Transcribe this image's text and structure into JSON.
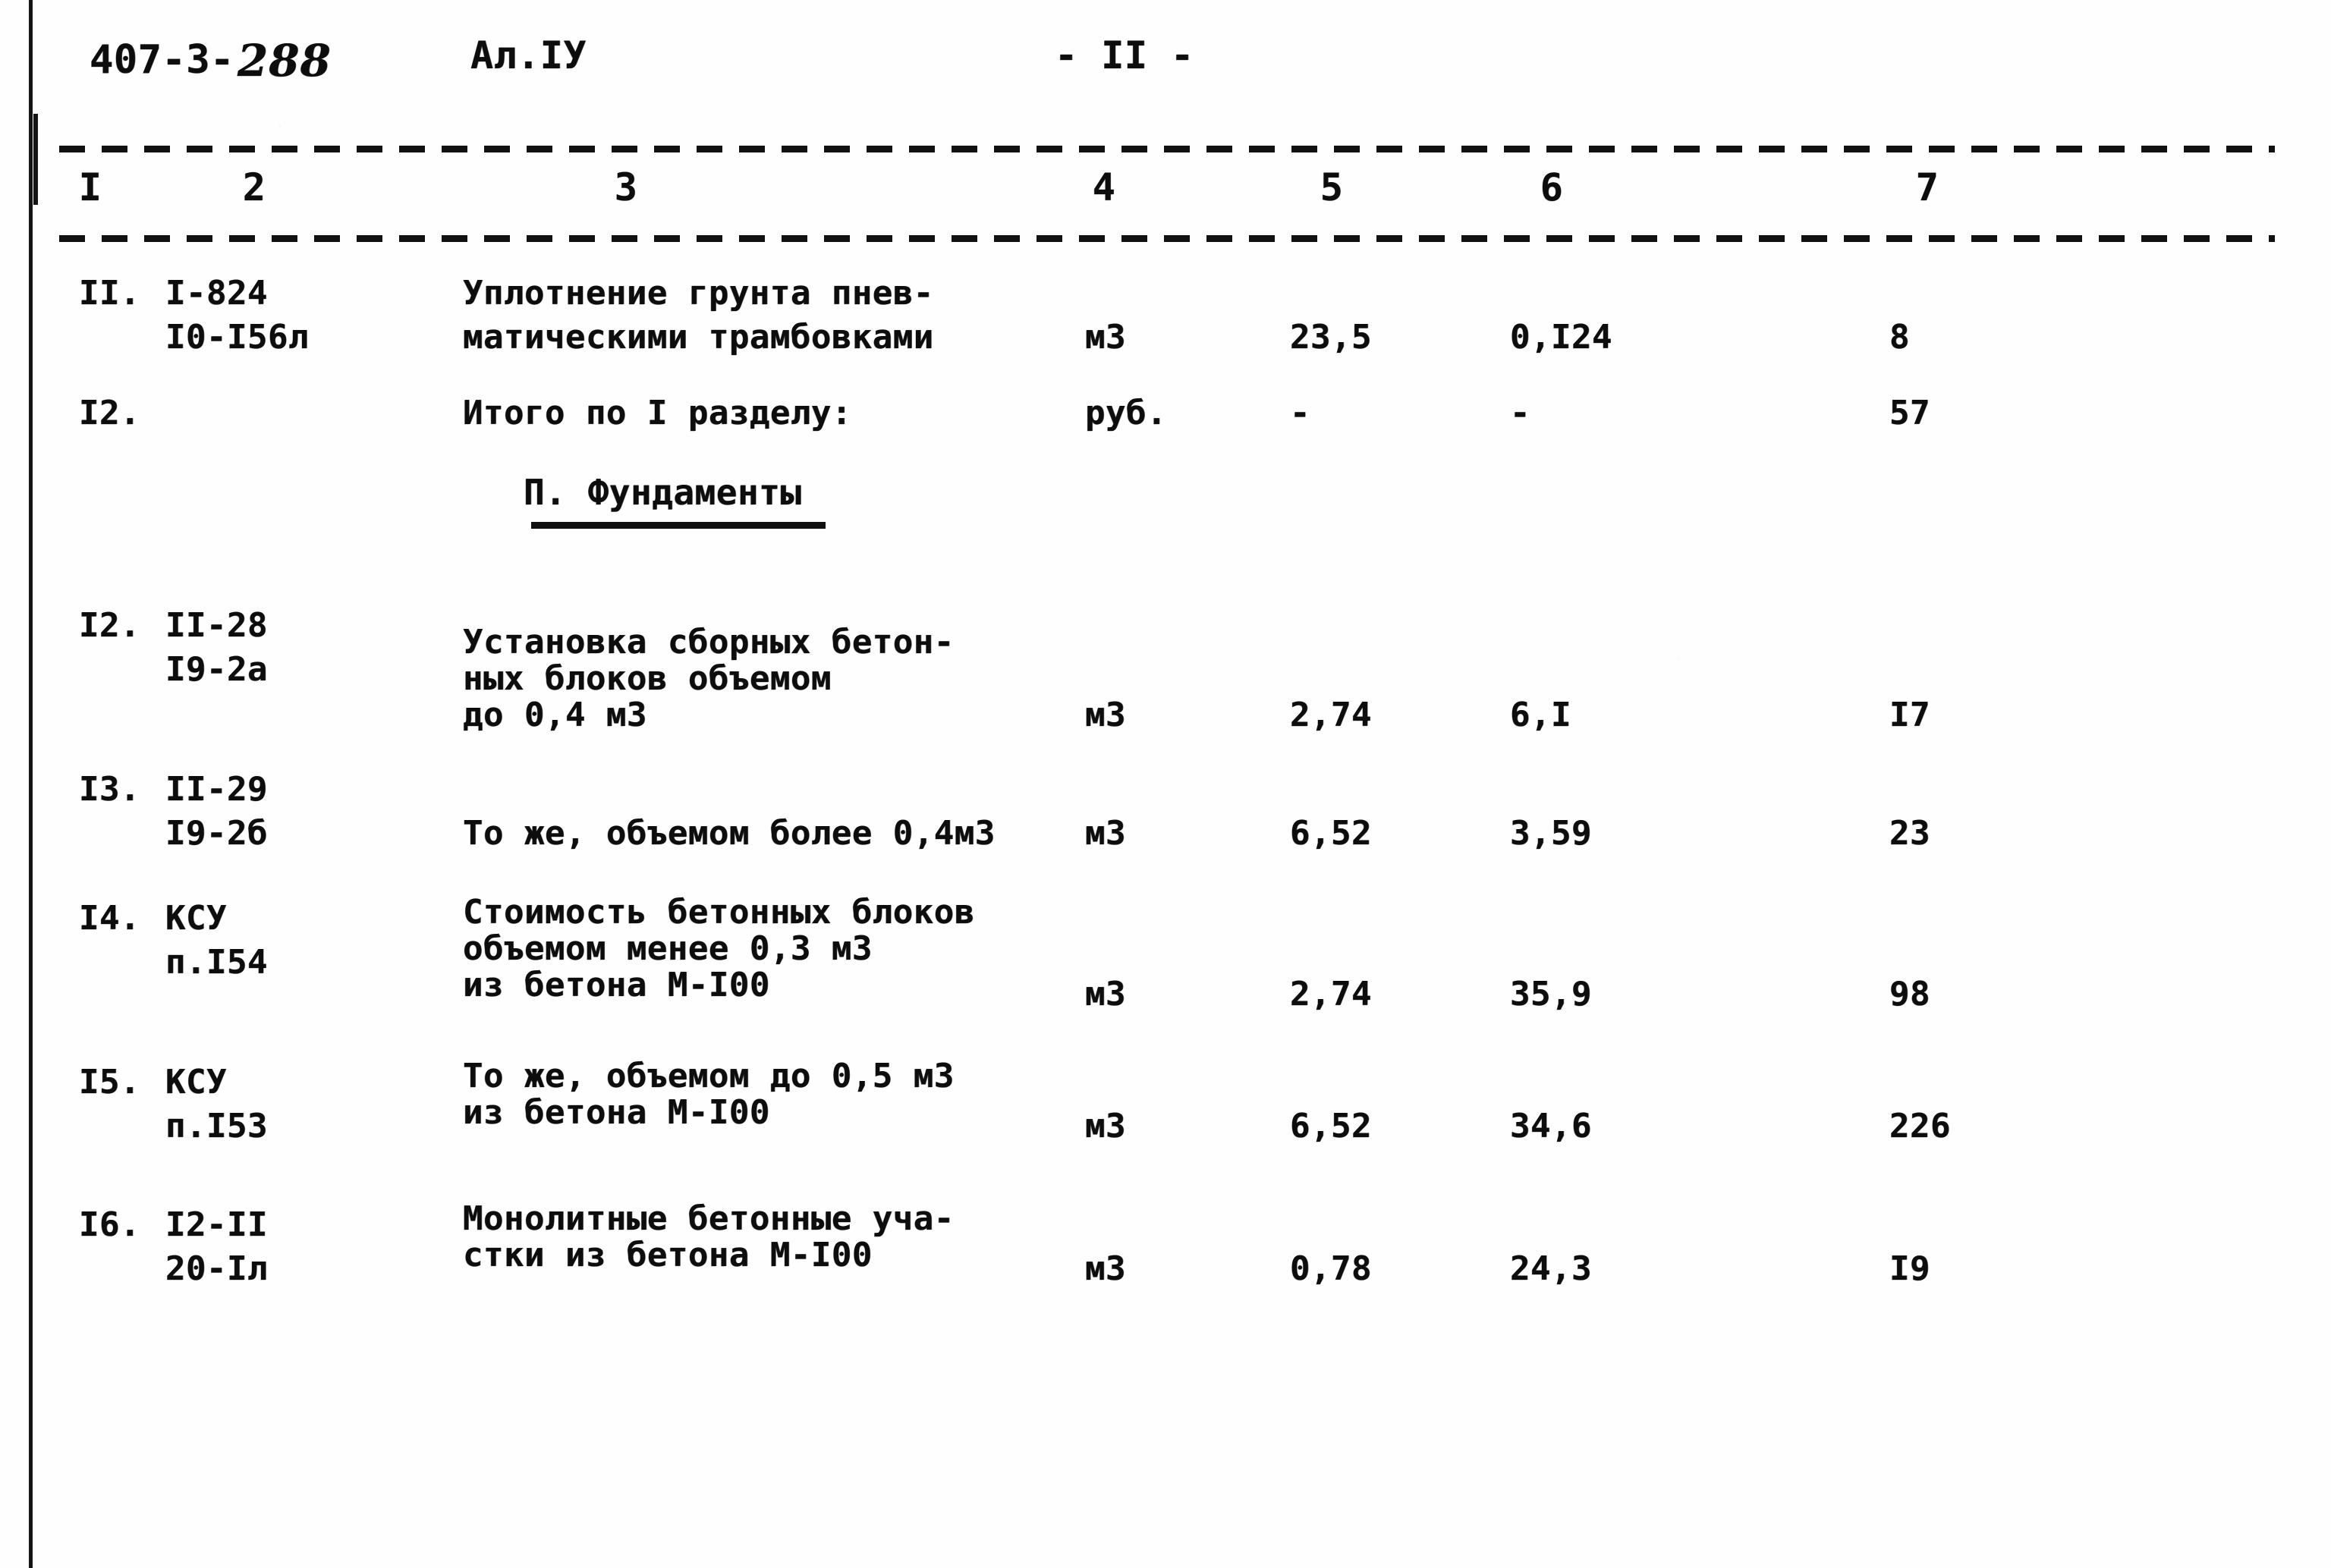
{
  "document": {
    "project_code_typed": "407-3-",
    "project_code_handwritten": "288",
    "album": "Ал.IУ",
    "page_marker": "- II -"
  },
  "table": {
    "column_numbers": [
      "I",
      "2",
      "3",
      "4",
      "5",
      "6",
      "7"
    ],
    "rows": [
      {
        "pos": "II.",
        "justification_line1": "I-824",
        "justification_line2": "I0-I56л",
        "name_line1": "Уплотнение грунта пнев-",
        "name_line2": "матическими трамбовками",
        "name_line3": "",
        "unit": "м3",
        "quantity": "23,5",
        "unit_price": "0,I24",
        "total": "8"
      },
      {
        "pos": "I2.",
        "justification_line1": "",
        "justification_line2": "",
        "name_line1": "Итого по I разделу:",
        "name_line2": "",
        "name_line3": "",
        "unit": "руб.",
        "quantity": "-",
        "unit_price": "-",
        "total": "57"
      },
      {
        "pos": "I2.",
        "justification_line1": "II-28",
        "justification_line2": "I9-2а",
        "name_line1": "Установка сборных бетон-",
        "name_line2": "ных блоков объемом",
        "name_line3": "до 0,4 м3",
        "unit": "м3",
        "quantity": "2,74",
        "unit_price": "6,I",
        "total": "I7"
      },
      {
        "pos": "I3.",
        "justification_line1": "II-29",
        "justification_line2": "I9-2б",
        "name_line1": "",
        "name_line2": "То же, объемом более 0,4м3",
        "name_line3": "",
        "unit": "м3",
        "quantity": "6,52",
        "unit_price": "3,59",
        "total": "23"
      },
      {
        "pos": "I4.",
        "justification_line1": "КСУ",
        "justification_line2": "п.I54",
        "name_line1": "Стоимость бетонных блоков",
        "name_line2": "объемом менее 0,3 м3",
        "name_line3": "из бетона М-I00",
        "unit": "м3",
        "quantity": "2,74",
        "unit_price": "35,9",
        "total": "98"
      },
      {
        "pos": "I5.",
        "justification_line1": "КСУ",
        "justification_line2": "п.I53",
        "name_line1": "То же, объемом до 0,5 м3",
        "name_line2": "из бетона М-I00",
        "name_line3": "",
        "unit": "м3",
        "quantity": "6,52",
        "unit_price": "34,6",
        "total": "226"
      },
      {
        "pos": "I6.",
        "justification_line1": "I2-II",
        "justification_line2": "20-Iл",
        "name_line1": "Монолитные бетонные уча-",
        "name_line2": "стки из бетона М-I00",
        "name_line3": "",
        "unit": "м3",
        "quantity": "0,78",
        "unit_price": "24,3",
        "total": "I9"
      }
    ],
    "section_heading": "П. Фундаменты"
  }
}
